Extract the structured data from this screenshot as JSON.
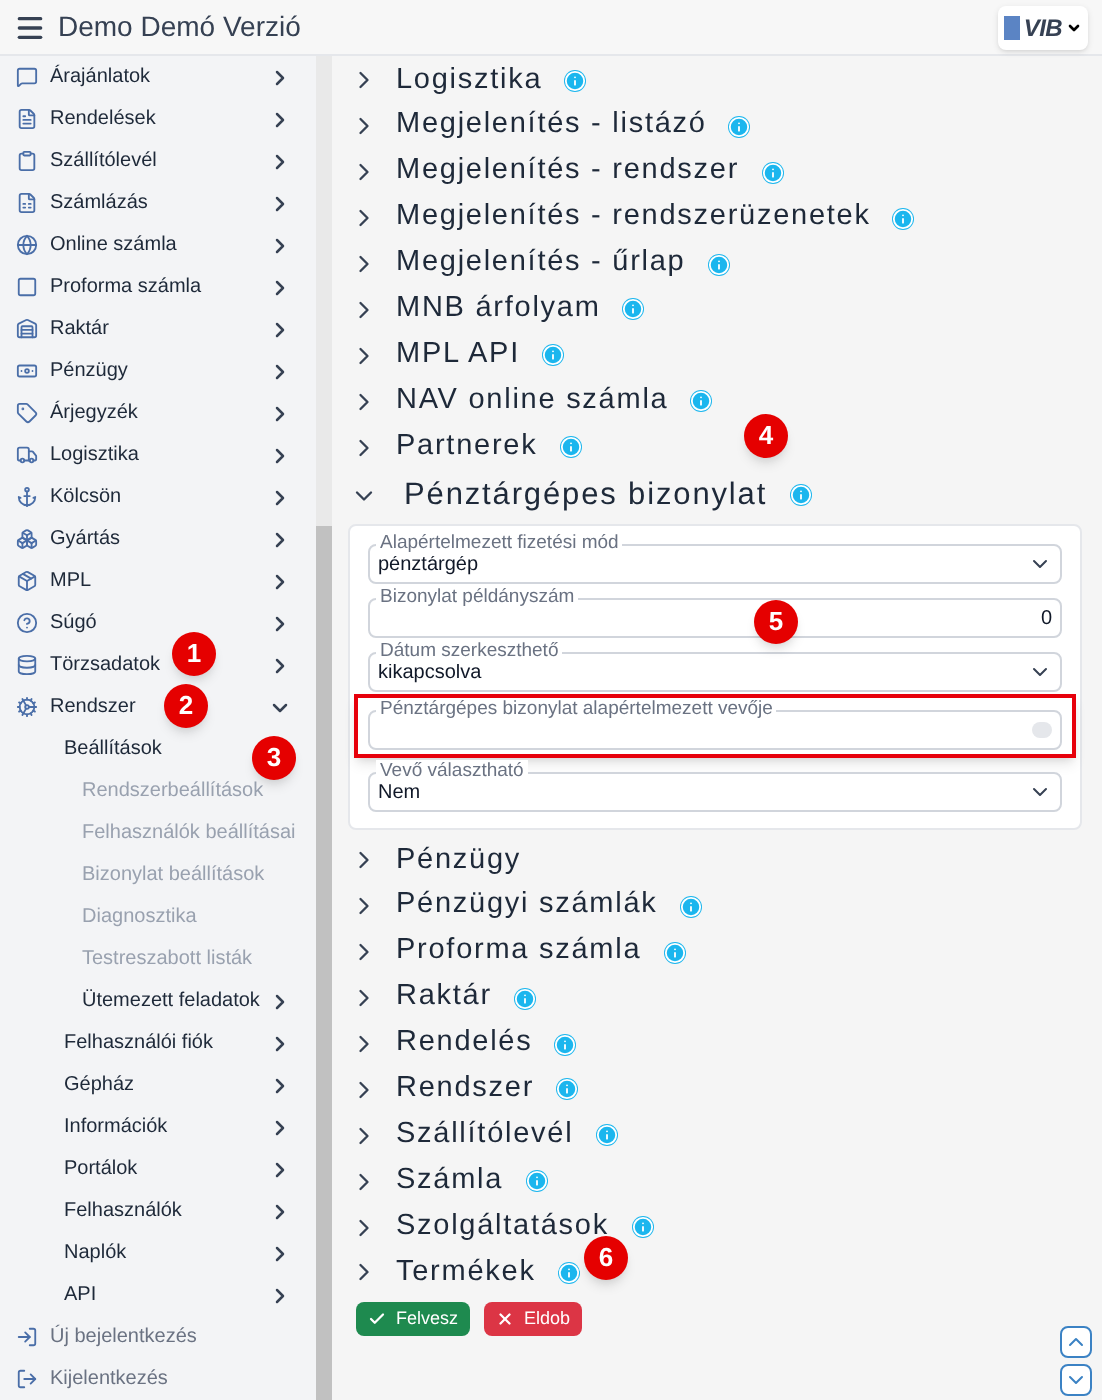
{
  "header": {
    "title": "Demo Demó Verzió",
    "logo": "VIB"
  },
  "sidebar": {
    "items": [
      {
        "label": "Árajánlatok",
        "expanded": false
      },
      {
        "label": "Rendelések",
        "expanded": false
      },
      {
        "label": "Szállítólevél",
        "expanded": false
      },
      {
        "label": "Számlázás",
        "expanded": false
      },
      {
        "label": "Online számla",
        "expanded": false
      },
      {
        "label": "Proforma számla",
        "expanded": false
      },
      {
        "label": "Raktár",
        "expanded": false
      },
      {
        "label": "Pénzügy",
        "expanded": false
      },
      {
        "label": "Árjegyzék",
        "expanded": false
      },
      {
        "label": "Logisztika",
        "expanded": false
      },
      {
        "label": "Kölcsön",
        "expanded": false
      },
      {
        "label": "Gyártás",
        "expanded": false
      },
      {
        "label": "MPL",
        "expanded": false
      },
      {
        "label": "Súgó",
        "expanded": false
      },
      {
        "label": "Törzsadatok",
        "expanded": false
      },
      {
        "label": "Rendszer",
        "expanded": true,
        "children": [
          {
            "label": "Beállítások",
            "children": [
              {
                "label": "Rendszerbeállítások"
              },
              {
                "label": "Felhasználók beállításai"
              },
              {
                "label": "Bizonylat beállítások"
              },
              {
                "label": "Diagnosztika"
              },
              {
                "label": "Testreszabott listák"
              },
              {
                "label": "Ütemezett feladatok",
                "expanded": false
              }
            ]
          },
          {
            "label": "Felhasználói fiók",
            "expanded": false
          },
          {
            "label": "Gépház",
            "expanded": false
          },
          {
            "label": "Információk",
            "expanded": false
          },
          {
            "label": "Portálok",
            "expanded": false
          },
          {
            "label": "Felhasználók",
            "expanded": false
          },
          {
            "label": "Naplók",
            "expanded": false
          },
          {
            "label": "API",
            "expanded": false
          }
        ]
      }
    ],
    "footer": [
      "Új bejelentkezés",
      "Kijelentkezés"
    ]
  },
  "settings": [
    {
      "label": "Logisztika",
      "info": true,
      "expanded": false
    },
    {
      "label": "Megjelenítés - listázó",
      "info": true,
      "expanded": false
    },
    {
      "label": "Megjelenítés - rendszer",
      "info": true,
      "expanded": false
    },
    {
      "label": "Megjelenítés - rendszerüzenetek",
      "info": true,
      "expanded": false
    },
    {
      "label": "Megjelenítés - űrlap",
      "info": true,
      "expanded": false
    },
    {
      "label": "MNB árfolyam",
      "info": true,
      "expanded": false
    },
    {
      "label": "MPL API",
      "info": true,
      "expanded": false
    },
    {
      "label": "NAV online számla",
      "info": true,
      "expanded": false
    },
    {
      "label": "Partnerek",
      "info": true,
      "expanded": false
    },
    {
      "label": "Pénztárgépes bizonylat",
      "info": true,
      "expanded": true,
      "fields": [
        {
          "kind": "select",
          "label": "Alapértelmezett fizetési mód",
          "value": "pénztárgép",
          "highlighted": false
        },
        {
          "kind": "number",
          "label": "Bizonylat példányszám",
          "value": "0",
          "highlighted": false
        },
        {
          "kind": "select",
          "label": "Dátum szerkeszthető",
          "value": "kikapcsolva",
          "highlighted": false
        },
        {
          "kind": "text",
          "label": "Pénztárgépes bizonylat alapértelmezett vevője",
          "highlighted": true
        },
        {
          "kind": "select",
          "label": "Vevő választható",
          "value": "Nem",
          "highlighted": false
        }
      ]
    },
    {
      "label": "Pénzügy",
      "info": false,
      "expanded": false
    },
    {
      "label": "Pénzügyi számlák",
      "info": true,
      "expanded": false
    },
    {
      "label": "Proforma számla",
      "info": true,
      "expanded": false
    },
    {
      "label": "Raktár",
      "info": true,
      "expanded": false
    },
    {
      "label": "Rendelés",
      "info": true,
      "expanded": false
    },
    {
      "label": "Rendszer",
      "info": true,
      "expanded": false
    },
    {
      "label": "Szállítólevél",
      "info": true,
      "expanded": false
    },
    {
      "label": "Számla",
      "info": true,
      "expanded": false
    },
    {
      "label": "Szolgáltatások",
      "info": true,
      "expanded": false
    },
    {
      "label": "Termékek",
      "info": true,
      "expanded": false
    }
  ],
  "buttons": [
    {
      "kind": "save",
      "label": "Felvesz"
    },
    {
      "kind": "discard",
      "label": "Eldob"
    }
  ],
  "callouts": [
    "1",
    "2",
    "3",
    "4",
    "5",
    "6"
  ]
}
